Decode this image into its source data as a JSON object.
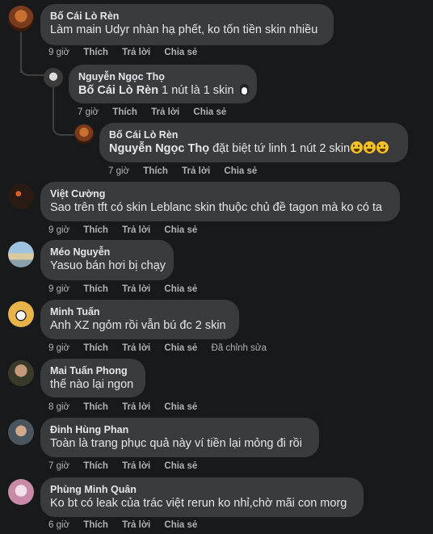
{
  "comments": [
    {
      "author": "Bố Cái Lò Rèn",
      "text": "Làm main Udyr nhàn hạ phết, ko tốn tiền skin nhiều",
      "time": "9 giờ",
      "like": "Thích",
      "reply": "Trả lời",
      "share": "Chia sẻ",
      "avatar_color": "#8a4a2a"
    },
    {
      "author": "Nguyễn Ngọc Thọ",
      "mention": "Bố Cái Lò Rèn",
      "text": " 1 nút là 1 skin ",
      "time": "7 giờ",
      "like": "Thích",
      "reply": "Trả lời",
      "share": "Chia sẻ",
      "avatar_color": "#6a6a6a"
    },
    {
      "author": "Bố Cái Lò Rèn",
      "mention": "Nguyễn Ngọc Thọ",
      "text": " đặt biệt tứ linh 1 nút 2 skin",
      "time": "7 giờ",
      "like": "Thích",
      "reply": "Trả lời",
      "share": "Chia sẻ",
      "avatar_color": "#8a4a2a"
    },
    {
      "author": "Việt Cường",
      "text": "Sao trên tft có skin Leblanc skin thuộc chủ đề tagon mà ko có ta",
      "time": "9 giờ",
      "like": "Thích",
      "reply": "Trả lời",
      "share": "Chia sẻ",
      "avatar_color": "#2a1a14"
    },
    {
      "author": "Méo Nguyễn",
      "text": "Yasuo bán hơi bị chạy",
      "time": "9 giờ",
      "like": "Thích",
      "reply": "Trả lời",
      "share": "Chia sẻ",
      "avatar_color": "#7fa7c9"
    },
    {
      "author": "Minh Tuấn",
      "text": "Anh XZ ngỏm rồi vẫn bú đc 2 skin",
      "time": "9 giờ",
      "like": "Thích",
      "reply": "Trả lời",
      "share": "Chia sẻ",
      "edited": "Đã chỉnh sửa",
      "avatar_color": "#d9a441"
    },
    {
      "author": "Mai Tuấn Phong",
      "text": "thế nào lại ngon",
      "time": "8 giờ",
      "like": "Thích",
      "reply": "Trả lời",
      "share": "Chia sẻ",
      "avatar_color": "#4a5a3a"
    },
    {
      "author": "Đinh Hùng Phan",
      "text": "Toàn là trang phục quả này ví tiền lại mỏng đi rồi",
      "time": "7 giờ",
      "like": "Thích",
      "reply": "Trả lời",
      "share": "Chia sẻ",
      "avatar_color": "#5d6b7a"
    },
    {
      "author": "Phùng Minh Quân",
      "text": "Ko bt có leak của trác việt rerun ko nhỉ,chờ mãi con morg",
      "time": "6 giờ",
      "like": "Thích",
      "reply": "Trả lời",
      "share": "Chia sẻ",
      "avatar_color": "#d8a8c0"
    }
  ]
}
